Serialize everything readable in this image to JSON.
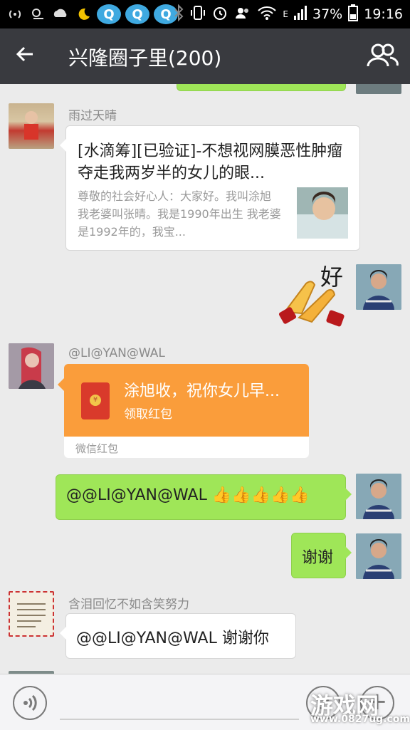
{
  "status_bar": {
    "battery": "37%",
    "time": "19:16",
    "network_label": "E",
    "icons": [
      "wifi-hotspot-icon",
      "weather-sun-icon",
      "weather-cloud-icon",
      "moon-icon",
      "qq-icon",
      "qq-icon",
      "qq-icon",
      "bluetooth-icon",
      "vibrate-icon",
      "alarm-icon",
      "contacts-icon",
      "wifi-icon",
      "signal-icon",
      "battery-icon"
    ]
  },
  "header": {
    "title": "兴隆圈子里(200)",
    "back_icon": "arrow-left-icon",
    "group_icon": "group-members-icon"
  },
  "messages": [
    {
      "type": "link",
      "sender": "雨过天晴",
      "title": "[水滴筹][已验证]-不想视网膜恶性肿瘤夺走我两岁半的女儿的眼...",
      "description": "尊敬的社会好心人：大家好。我叫涂旭 我老婆叫张晴。我是1990年出生 我老婆是1992年的，我宝..."
    },
    {
      "type": "sticker",
      "sender": "self",
      "sticker_text": "好"
    },
    {
      "type": "red_packet",
      "sender": "@LI@YAN@WAL",
      "title": "涂旭收，祝你女儿早...",
      "subtitle": "领取红包",
      "footer": "微信红包"
    },
    {
      "type": "text",
      "sender": "self",
      "text": "@@LI@YAN@WAL 👍👍👍👍👍"
    },
    {
      "type": "text",
      "sender": "self",
      "text": "谢谢"
    },
    {
      "type": "text",
      "sender": "含泪回忆不如含笑努力",
      "text": "@@LI@YAN@WAL 谢谢你"
    }
  ],
  "input_bar": {
    "voice_icon": "voice-icon",
    "emoji_icon": "emoji-icon",
    "plus_icon": "plus-icon"
  },
  "watermark": {
    "text": "游戏网",
    "url": "www.0827ug.com"
  },
  "colors": {
    "titlebar": "#393a3f",
    "chat_bg": "#ebebeb",
    "self_bubble": "#9fe658",
    "red_packet": "#fa9d3b"
  }
}
